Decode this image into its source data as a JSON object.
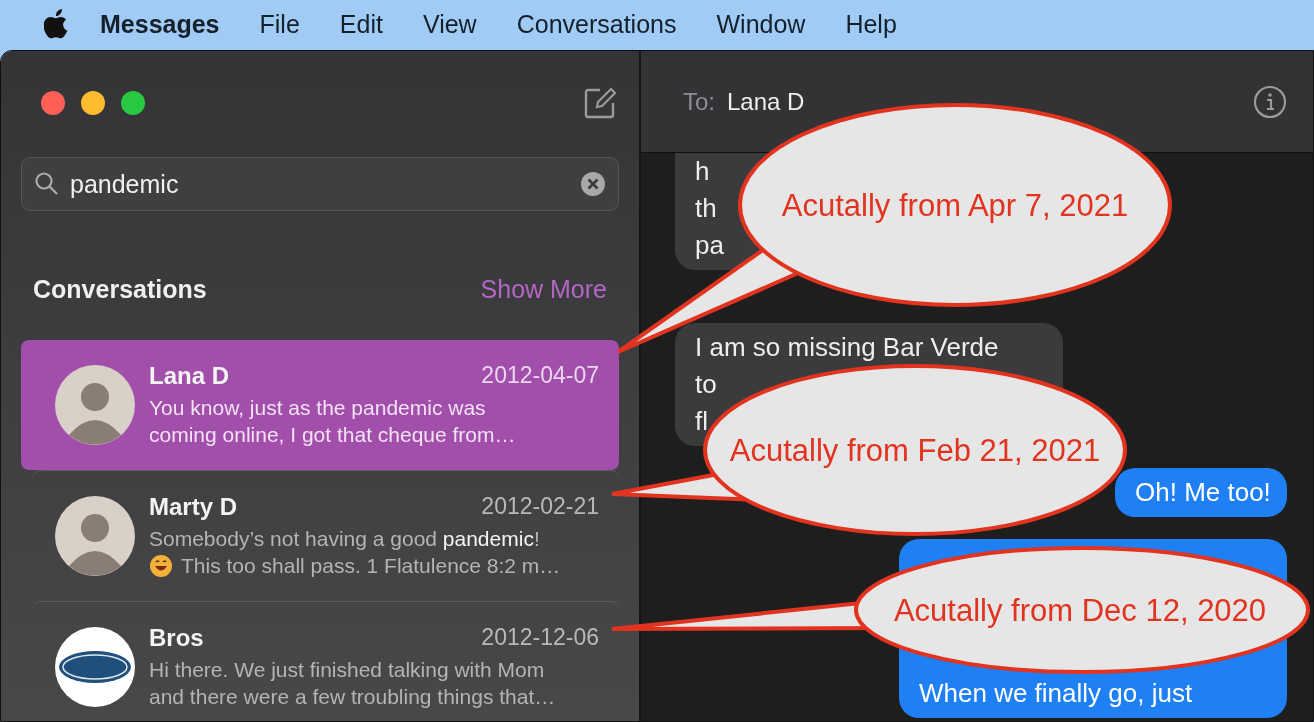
{
  "menu_bar": {
    "items": [
      {
        "label": "Messages",
        "kind": "app"
      },
      {
        "label": "File",
        "kind": "menu"
      },
      {
        "label": "Edit",
        "kind": "menu"
      },
      {
        "label": "View",
        "kind": "menu"
      },
      {
        "label": "Conversations",
        "kind": "menu"
      },
      {
        "label": "Window",
        "kind": "menu"
      },
      {
        "label": "Help",
        "kind": "menu"
      }
    ]
  },
  "sidebar": {
    "search": {
      "value": "pandemic"
    },
    "section_title": "Conversations",
    "show_more": "Show More",
    "conversations": [
      {
        "name": "Lana D",
        "date": "2012-04-07",
        "lines": [
          "You know, just as the pandemic was",
          "coming online, I got that cheque from…"
        ],
        "emoji": false,
        "kind": "person",
        "selected": true
      },
      {
        "name": "Marty D",
        "date": "2012-02-21",
        "lines": [
          "Somebody’s not having a good **pandemic**!",
          "This too shall pass. 1 Flatulence 8:2 m…"
        ],
        "emoji": true,
        "kind": "person",
        "selected": false
      },
      {
        "name": "Bros",
        "date": "2012-12-06",
        "lines": [
          "Hi there. We just finished talking with Mom",
          "and there were a few troubling things that…"
        ],
        "emoji": false,
        "kind": "logo",
        "selected": false
      }
    ]
  },
  "conversation": {
    "to_label": "To:",
    "recipient": "Lana D",
    "messages": [
      {
        "kind": "incoming",
        "lines": [
          "h",
          "th",
          "pa"
        ]
      },
      {
        "kind": "incoming",
        "lines": [
          "I am so missing Bar Verde",
          "to",
          "fl"
        ]
      },
      {
        "kind": "outgoing",
        "lines": [
          "Oh! Me too!"
        ]
      },
      {
        "kind": "outgoing",
        "lines": [
          "When we finally go, just"
        ]
      }
    ]
  },
  "callouts": [
    {
      "text": "Acutally from Apr 7, 2021"
    },
    {
      "text": "Acutally from Feb 21, 2021"
    },
    {
      "text": "Acutally from Dec 12, 2020"
    }
  ]
}
